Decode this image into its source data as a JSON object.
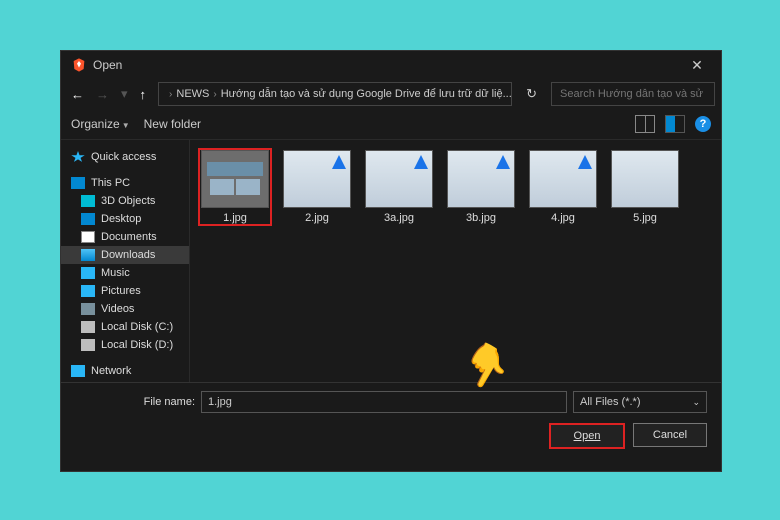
{
  "title": "Open",
  "breadcrumb": {
    "segment1": "NEWS",
    "segment2": "Hướng dẫn tạo và sử dụng Google Drive để lưu trữ dữ liệ..."
  },
  "search": {
    "placeholder": "Search Hướng dẫn tạo và sử d..."
  },
  "toolbar": {
    "organize": "Organize",
    "newfolder": "New folder"
  },
  "sidebar": {
    "quick_access": "Quick access",
    "this_pc": "This PC",
    "items": [
      "3D Objects",
      "Desktop",
      "Documents",
      "Downloads",
      "Music",
      "Pictures",
      "Videos",
      "Local Disk (C:)",
      "Local Disk (D:)"
    ],
    "network": "Network"
  },
  "files": [
    {
      "name": "1.jpg",
      "selected": true
    },
    {
      "name": "2.jpg",
      "selected": false
    },
    {
      "name": "3a.jpg",
      "selected": false
    },
    {
      "name": "3b.jpg",
      "selected": false
    },
    {
      "name": "4.jpg",
      "selected": false
    },
    {
      "name": "5.jpg",
      "selected": false
    }
  ],
  "bottom": {
    "filename_label": "File name:",
    "filename_value": "1.jpg",
    "filetype": "All Files (*.*)",
    "open": "Open",
    "cancel": "Cancel"
  }
}
